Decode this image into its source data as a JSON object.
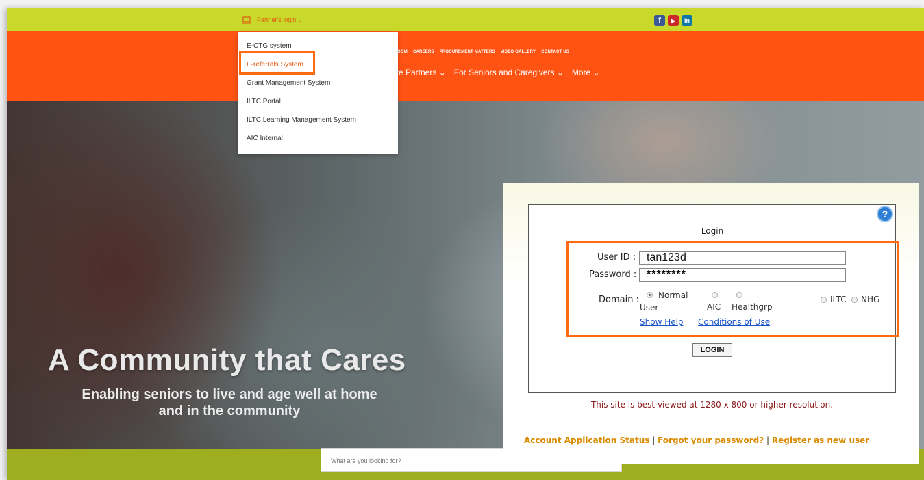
{
  "topbar": {
    "partner_login_label": "Partner's login ⌄",
    "social": [
      {
        "icon": "facebook-icon",
        "glyph": "f",
        "color": "#3b5998"
      },
      {
        "icon": "youtube-icon",
        "glyph": "▶",
        "color": "#cc2a2a"
      },
      {
        "icon": "linkedin-icon",
        "glyph": "in",
        "color": "#0e76a8"
      }
    ]
  },
  "nav": {
    "top_links": [
      "OOM",
      "CAREERS",
      "PROCUREMENT MATTERS",
      "VIDEO GALLERY",
      "CONTACT US"
    ],
    "main_links": [
      "re Partners ⌄",
      "For Seniors and Caregivers ⌄",
      "More ⌄"
    ]
  },
  "dropdown": {
    "items": [
      "E-CTG system",
      "E-referrals System",
      "Grant Management System",
      "ILTC Portal",
      "ILTC Learning Management System",
      "AIC Internal"
    ]
  },
  "hero": {
    "title": "A Community that Cares",
    "subtitle": "Enabling seniors to live and age well at home and in the community"
  },
  "search": {
    "placeholder": "What are you looking for?"
  },
  "login": {
    "help_glyph": "?",
    "title": "Login",
    "user_id_label": "User ID :",
    "user_id_value": "tan123d",
    "password_label": "Password :",
    "password_value": "********",
    "domain_label": "Domain :",
    "domains": [
      {
        "line1": "Normal",
        "line2": "User",
        "selected": true
      },
      {
        "line1": "",
        "line2": "AIC",
        "selected": false
      },
      {
        "line1": "",
        "line2": "Healthgrp",
        "selected": false
      },
      {
        "line1": "ILTC",
        "line2": "",
        "selected": false
      },
      {
        "line1": "NHG",
        "line2": "",
        "selected": false
      }
    ],
    "show_help": "Show Help",
    "conditions": "Conditions of Use",
    "button": "LOGIN",
    "note": "This site is best viewed at 1280 x 800 or higher resolution.",
    "account_status": "Account Application Status",
    "forgot": "Forgot your password?",
    "register": "Register as new user",
    "sep": "|"
  },
  "colors": {
    "topbar": "#c8d92b",
    "orange": "#ff5314",
    "highlight": "#ff6a13",
    "link": "#1a55c8",
    "gold_link": "#d98b00"
  }
}
